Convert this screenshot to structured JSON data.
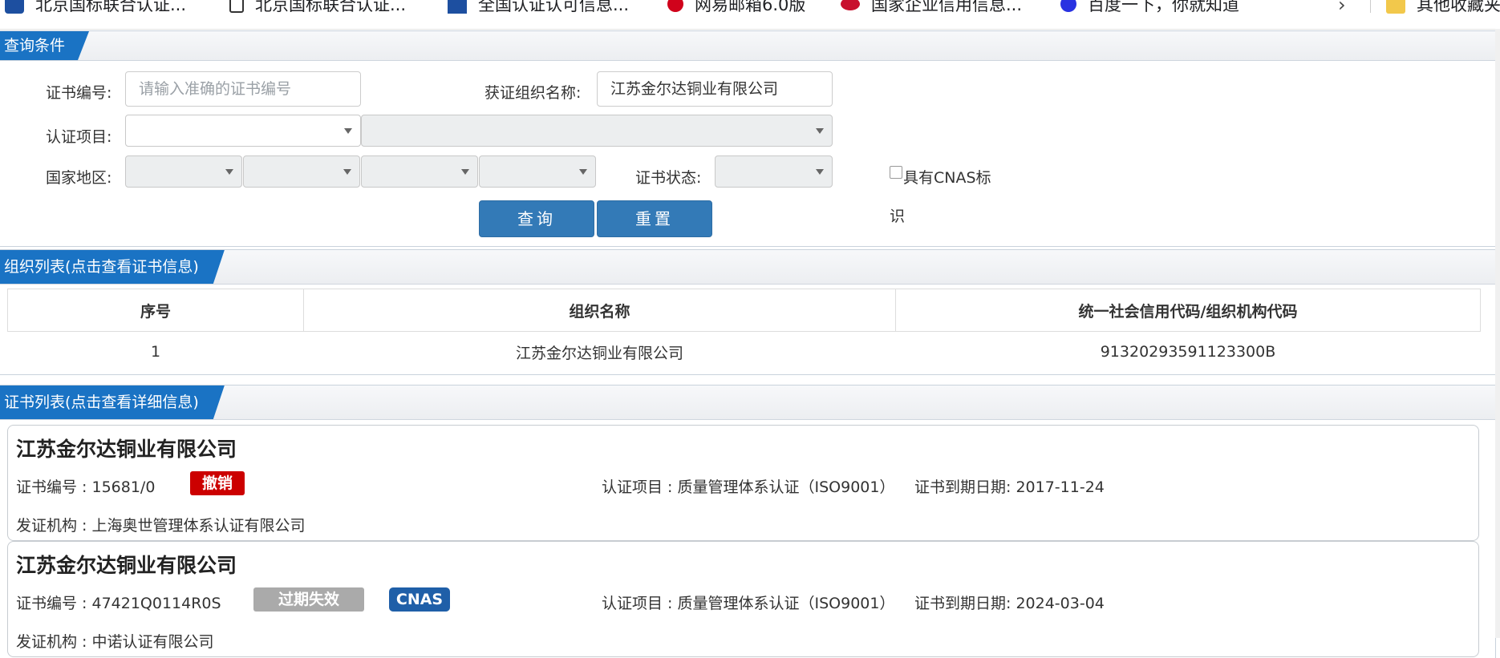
{
  "bookmarks": [
    {
      "label": "北京国标联合认证...",
      "icon": "blue-logo-icon"
    },
    {
      "label": "北京国标联合认证...",
      "icon": "page-icon"
    },
    {
      "label": "全国认证认可信息...",
      "icon": "blue-grid-icon"
    },
    {
      "label": "网易邮箱6.0版",
      "icon": "netease-icon"
    },
    {
      "label": "国家企业信用信息...",
      "icon": "red-emblem-icon"
    },
    {
      "label": "百度一下，你就知道",
      "icon": "baidu-paw-icon"
    },
    {
      "label": "其他收藏夹",
      "icon": "folder-icon"
    }
  ],
  "query": {
    "section_title": "查询条件",
    "cert_no_label": "证书编号:",
    "cert_no_placeholder": "请输入准确的证书编号",
    "org_name_label": "获证组织名称:",
    "org_name_value": "江苏金尔达铜业有限公司",
    "project_label": "认证项目:",
    "region_label": "国家地区:",
    "status_label": "证书状态:",
    "cnas_label_1": "具有CNAS标",
    "cnas_label_2": "识",
    "search_button": "查询",
    "reset_button": "重置"
  },
  "org_list": {
    "section_title": "组织列表(点击查看证书信息)",
    "headers": [
      "序号",
      "组织名称",
      "统一社会信用代码/组织机构代码"
    ],
    "rows": [
      [
        "1",
        "江苏金尔达铜业有限公司",
        "91320293591123300B"
      ]
    ]
  },
  "cert_list": {
    "section_title": "证书列表(点击查看详细信息)",
    "cert_no_prefix": "证书编号 : ",
    "project_prefix": "认证项目 : ",
    "expiry_prefix": "证书到期日期: ",
    "issuer_prefix": "发证机构 : ",
    "items": [
      {
        "org": "江苏金尔达铜业有限公司",
        "cert_no": "15681/0",
        "status": "撤销",
        "project": "质量管理体系认证（ISO9001）",
        "expiry": "2017-11-24",
        "issuer": "上海奥世管理体系认证有限公司"
      },
      {
        "org": "江苏金尔达铜业有限公司",
        "cert_no": "47421Q0114R0S",
        "status": "过期失效",
        "cnas": "CNAS",
        "project": "质量管理体系认证（ISO9001）",
        "expiry": "2024-03-04",
        "issuer": "中诺认证有限公司"
      }
    ]
  },
  "colors": {
    "accent": "#1a73c4",
    "button": "#337ab7",
    "revoked": "#cc0000",
    "expired": "#aaaaaa",
    "cnas": "#1f5fa8"
  }
}
